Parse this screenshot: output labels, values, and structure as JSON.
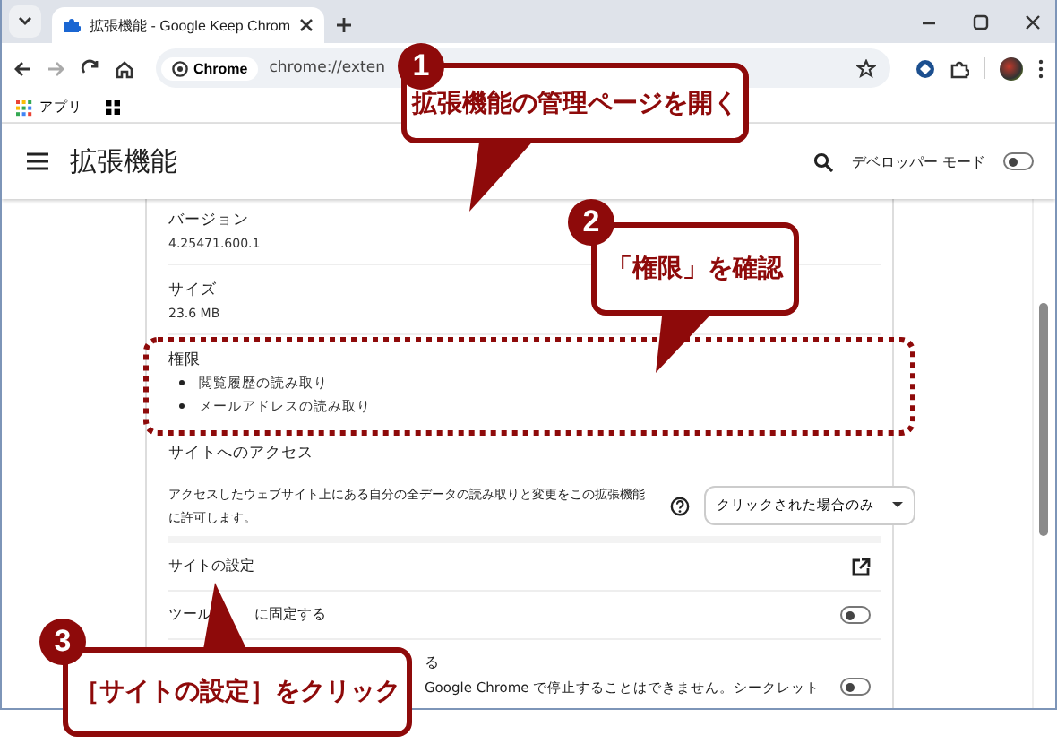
{
  "tabs": [
    {
      "title": "拡張機能 - Google Keep Chrom",
      "selected": true
    }
  ],
  "address_bar": {
    "chip": "Chrome",
    "url": "chrome://exten"
  },
  "bookmarks": [
    {
      "label": "アプリ"
    }
  ],
  "page": {
    "title": "拡張機能",
    "developer_mode": {
      "label": "デベロッパー モード",
      "on": false
    }
  },
  "details": [
    {
      "label": "バージョン",
      "value": "4.25471.600.1"
    },
    {
      "label": "サイズ",
      "value": "23.6 MB"
    }
  ],
  "permissions": {
    "title": "権限",
    "items": [
      "閲覧履歴の読み取り",
      "メールアドレスの読み取り"
    ]
  },
  "site_access": {
    "title": "サイトへのアクセス",
    "description": "アクセスしたウェブサイト上にある自分の全データの読み取りと変更をこの拡張機能に許可します。",
    "dropdown": "クリックされた場合のみ"
  },
  "site_settings": {
    "label": "サイトの設定"
  },
  "toggle_rows": [
    {
      "label_parts": [
        "ツール",
        "に固定する"
      ],
      "on": false
    },
    {
      "title": "る",
      "description": "Google Chrome で停止することはできません。シークレット",
      "on": false
    }
  ],
  "callouts": [
    {
      "number": "1",
      "text": "拡張機能の管理ページを開く"
    },
    {
      "number": "2",
      "text": "「権限」を確認"
    },
    {
      "number": "3",
      "text": "［サイトの設定］をクリック"
    }
  ]
}
